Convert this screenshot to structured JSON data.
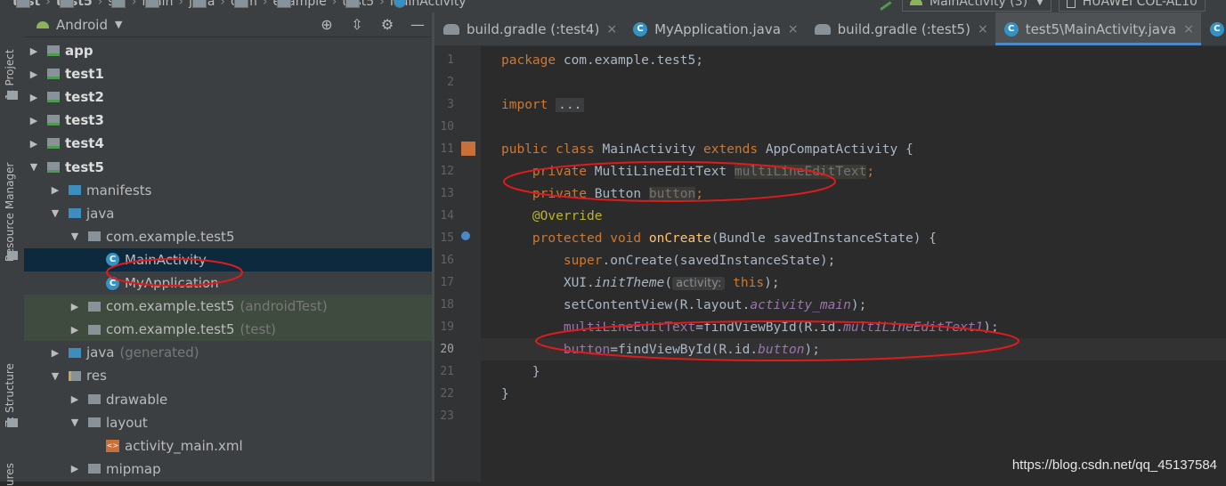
{
  "breadcrumbs": [
    {
      "label": "test",
      "bold": true
    },
    {
      "label": "test5",
      "bold": true
    },
    {
      "label": "src",
      "bold": false
    },
    {
      "label": "main",
      "bold": false
    },
    {
      "label": "java",
      "bold": false
    },
    {
      "label": "com",
      "bold": false
    },
    {
      "label": "example",
      "bold": false
    },
    {
      "label": "test5",
      "bold": false
    },
    {
      "label": "MainActivity",
      "bold": false
    }
  ],
  "run_config": "MainActivity (3)",
  "device": "HUAWEI COL-AL10",
  "tool_strip": {
    "project": "1: Project",
    "resource_manager": "Resource Manager",
    "structure": "Z: Structure",
    "captures": "ures"
  },
  "project_panel": {
    "view_mode": "Android",
    "items": [
      {
        "label": "app",
        "arrow": "▶",
        "depth": 0,
        "icon": "mod",
        "bold": true
      },
      {
        "label": "test1",
        "arrow": "▶",
        "depth": 0,
        "icon": "mod",
        "bold": true
      },
      {
        "label": "test2",
        "arrow": "▶",
        "depth": 0,
        "icon": "mod",
        "bold": true
      },
      {
        "label": "test3",
        "arrow": "▶",
        "depth": 0,
        "icon": "mod",
        "bold": true
      },
      {
        "label": "test4",
        "arrow": "▶",
        "depth": 0,
        "icon": "mod",
        "bold": true
      },
      {
        "label": "test5",
        "arrow": "▼",
        "depth": 0,
        "icon": "mod",
        "bold": true
      },
      {
        "label": "manifests",
        "arrow": "▶",
        "depth": 1,
        "icon": "blue"
      },
      {
        "label": "java",
        "arrow": "▼",
        "depth": 1,
        "icon": "blue"
      },
      {
        "label": "com.example.test5",
        "arrow": "▼",
        "depth": 2,
        "icon": "pkg"
      },
      {
        "label": "MainActivity",
        "arrow": "",
        "depth": 3,
        "icon": "class",
        "selected": true
      },
      {
        "label": "MyApplication",
        "arrow": "",
        "depth": 3,
        "icon": "class"
      },
      {
        "label": "com.example.test5",
        "suffix": "(androidTest)",
        "arrow": "▶",
        "depth": 2,
        "icon": "pkg",
        "test": true
      },
      {
        "label": "com.example.test5",
        "suffix": "(test)",
        "arrow": "▶",
        "depth": 2,
        "icon": "pkg",
        "test": true
      },
      {
        "label": "java",
        "suffix": "(generated)",
        "arrow": "▶",
        "depth": 1,
        "icon": "blue"
      },
      {
        "label": "res",
        "arrow": "▼",
        "depth": 1,
        "icon": "res"
      },
      {
        "label": "drawable",
        "arrow": "▶",
        "depth": 2,
        "icon": "pkg"
      },
      {
        "label": "layout",
        "arrow": "▼",
        "depth": 2,
        "icon": "pkg"
      },
      {
        "label": "activity_main.xml",
        "arrow": "",
        "depth": 3,
        "icon": "xml"
      },
      {
        "label": "mipmap",
        "arrow": "▶",
        "depth": 2,
        "icon": "pkg"
      }
    ]
  },
  "tabs": [
    {
      "label": "build.gradle (:test4)",
      "icon": "gradle",
      "active": false,
      "close": "×"
    },
    {
      "label": "MyApplication.java",
      "icon": "class",
      "active": false,
      "close": "×"
    },
    {
      "label": "build.gradle (:test5)",
      "icon": "gradle",
      "active": false,
      "close": "×"
    },
    {
      "label": "test5\\MainActivity.java",
      "icon": "class",
      "active": true,
      "close": "×"
    },
    {
      "label": "te",
      "icon": "class",
      "active": false,
      "close": ""
    }
  ],
  "line_numbers": [
    "1",
    "2",
    "3",
    "10",
    "11",
    "12",
    "13",
    "14",
    "15",
    "16",
    "17",
    "18",
    "19",
    "20",
    "21",
    "22",
    "23"
  ],
  "current_line": "20",
  "code": {
    "l1": {
      "kw": "package",
      "rest": " com.example.test5;"
    },
    "l3": {
      "kw": "import",
      "dots": "..."
    },
    "l11": {
      "kw": "public class",
      "cls": " MainActivity ",
      "kw2": "extends",
      "rest": " AppCompatActivity {"
    },
    "l12": {
      "kw": "private",
      "type": " MultiLineEditText ",
      "field": "multiLineEditText",
      "end": ";"
    },
    "l13": {
      "kw": "private",
      "type": " Button ",
      "field": "button",
      "end": ";"
    },
    "l14": {
      "ann": "@Override"
    },
    "l15": {
      "kw": "protected void",
      "fn": " onCreate",
      "rest": "(Bundle savedInstanceState) {"
    },
    "l16": {
      "kw": "super",
      "rest": ".onCreate(savedInstanceState);"
    },
    "l17": {
      "a": "XUI.",
      "st": "initTheme",
      "b": "(",
      "hint": "activity:",
      "kw": " this",
      "c": ");"
    },
    "l18": {
      "a": "setContentView(R.layout.",
      "it": "activity_main",
      "b": ");"
    },
    "l19": {
      "fld": "multiLineEditText",
      "a": "=findViewById(R.id.",
      "it": "multiLineEditText1",
      "b": ");"
    },
    "l20": {
      "fld": "button",
      "a": "=findViewById(R.id.",
      "it": "button",
      "b": ");"
    },
    "l21": "}",
    "l22": "}"
  },
  "watermark": "https://blog.csdn.net/qq_45137584",
  "colors": {
    "annotation_oval": "#e01b1b",
    "selection": "#0d293e",
    "active_tab_line": "#4a88c7"
  }
}
